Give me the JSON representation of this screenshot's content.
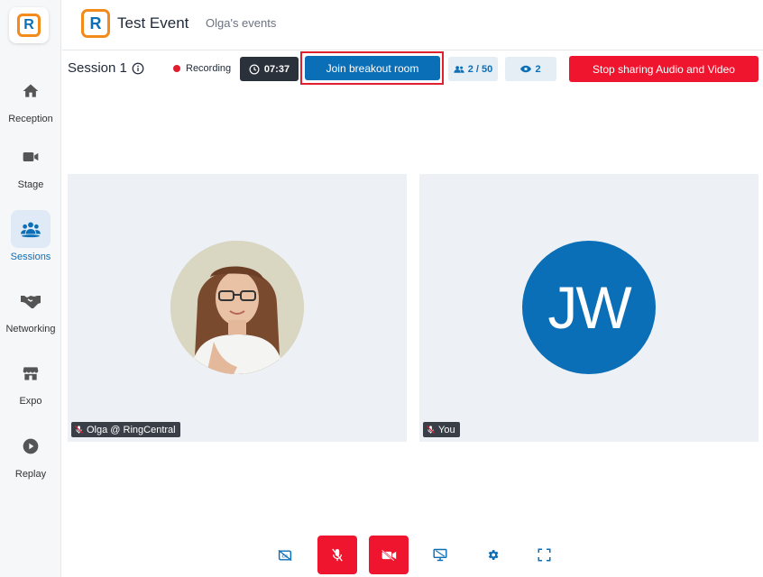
{
  "app": {
    "logo_letter": "R"
  },
  "sidebar": {
    "items": [
      {
        "label": "Reception",
        "icon": "home-icon"
      },
      {
        "label": "Stage",
        "icon": "video-camera-icon"
      },
      {
        "label": "Sessions",
        "icon": "people-group-icon",
        "active": true
      },
      {
        "label": "Networking",
        "icon": "handshake-icon"
      },
      {
        "label": "Expo",
        "icon": "storefront-icon"
      },
      {
        "label": "Replay",
        "icon": "play-circle-icon"
      }
    ]
  },
  "header": {
    "logo_letter": "R",
    "title": "Test Event",
    "owner": "Olga's events"
  },
  "session": {
    "title": "Session 1",
    "recording_label": "Recording",
    "timer": "07:37",
    "join_label": "Join breakout room",
    "attendees": "2 / 50",
    "viewers": "2",
    "stop_label": "Stop sharing Audio and Video"
  },
  "tiles": [
    {
      "name": "Olga @ RingCentral",
      "type": "photo"
    },
    {
      "name": "You",
      "initials": "JW",
      "type": "initials"
    }
  ],
  "colors": {
    "brand_blue": "#0a6fb7",
    "brand_orange": "#f28a1c",
    "danger_red": "#f0152e"
  }
}
